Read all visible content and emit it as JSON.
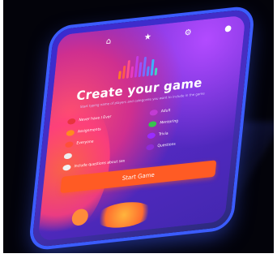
{
  "screen": {
    "title": "Create your game",
    "subtitle": "Start typing name of players and categories you want to include in the game",
    "categories": [
      {
        "label": "Never have I Ever",
        "color": "#e8343e"
      },
      {
        "label": "Adult",
        "color": "#c23bd3"
      },
      {
        "label": "Assignments",
        "color": "#ff8a1f"
      },
      {
        "label": "Mentoring",
        "color": "#38c24e"
      },
      {
        "label": "Everyone",
        "color": "#ff4f3a"
      },
      {
        "label": "Trivia",
        "color": "#9a2cff"
      },
      {
        "label": "",
        "color": "#eeeeee"
      },
      {
        "label": "Questions",
        "color": "#8f2bd8"
      }
    ],
    "toggle_label": "Include questions about sex",
    "start_button": "Start Game"
  },
  "icons": {
    "home": "home-icon",
    "star": "star-icon",
    "settings": "settings-icon",
    "info": "info-icon"
  },
  "colors": {
    "accent": "#ff5b24",
    "phone_frame": "#3b5cff"
  }
}
